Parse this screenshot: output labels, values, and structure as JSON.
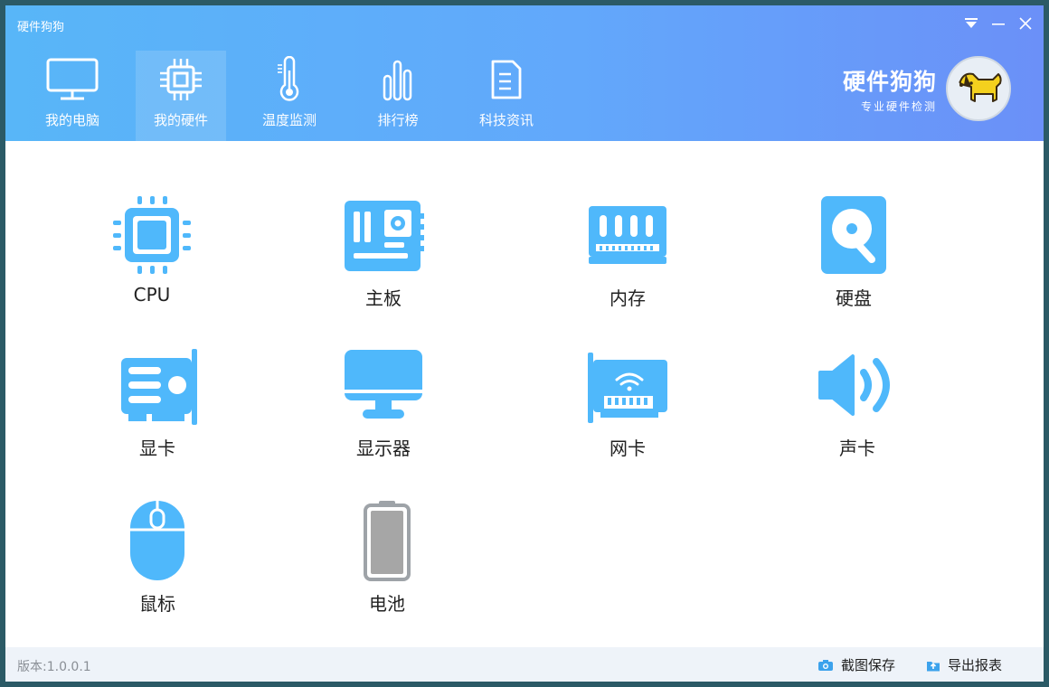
{
  "window": {
    "title": "硬件狗狗"
  },
  "nav": {
    "items": [
      {
        "label": "我的电脑",
        "icon": "monitor-icon"
      },
      {
        "label": "我的硬件",
        "icon": "chip-icon",
        "active": true
      },
      {
        "label": "温度监测",
        "icon": "thermometer-icon"
      },
      {
        "label": "排行榜",
        "icon": "bar-rank-icon"
      },
      {
        "label": "科技资讯",
        "icon": "news-doc-icon"
      }
    ]
  },
  "brand": {
    "name": "硬件狗狗",
    "tagline": "专业硬件检测",
    "logo": "dog-logo-icon"
  },
  "hardware": {
    "items": [
      {
        "label": "CPU",
        "icon": "cpu-icon"
      },
      {
        "label": "主板",
        "icon": "motherboard-icon"
      },
      {
        "label": "内存",
        "icon": "memory-icon"
      },
      {
        "label": "硬盘",
        "icon": "harddisk-icon"
      },
      {
        "label": "显卡",
        "icon": "graphics-card-icon"
      },
      {
        "label": "显示器",
        "icon": "display-icon"
      },
      {
        "label": "网卡",
        "icon": "network-card-icon"
      },
      {
        "label": "声卡",
        "icon": "sound-card-icon"
      },
      {
        "label": "鼠标",
        "icon": "mouse-icon"
      },
      {
        "label": "电池",
        "icon": "battery-icon"
      }
    ]
  },
  "footer": {
    "version": "版本:1.0.0.1",
    "screenshot_label": "截图保存",
    "export_label": "导出报表"
  },
  "colors": {
    "accent": "#4fb8fb",
    "header_start": "#58b6f8",
    "header_end": "#6b90f8",
    "battery": "#9ea3a8"
  }
}
